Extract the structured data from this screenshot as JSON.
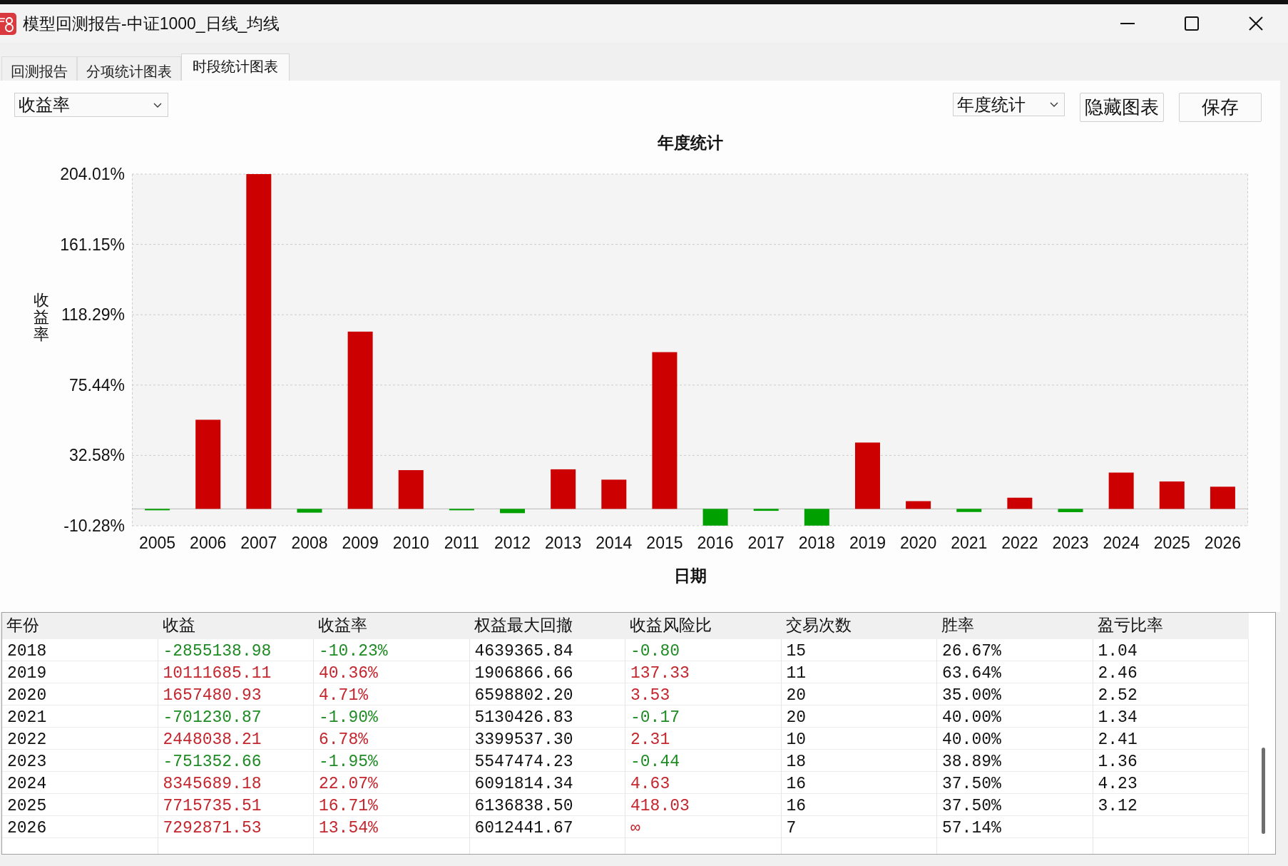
{
  "window": {
    "title": "模型回测报告-中证1000_日线_均线"
  },
  "tabs": [
    {
      "label": "回测报告",
      "selected": false
    },
    {
      "label": "分项统计图表",
      "selected": false
    },
    {
      "label": "时段统计图表",
      "selected": true
    }
  ],
  "toolbar": {
    "metric_select": {
      "value": "收益率"
    },
    "period_select": {
      "value": "年度统计"
    },
    "buttons": [
      "隐藏图表",
      "保存"
    ]
  },
  "chart": {
    "chart_data": [
      {
        "type": "bar",
        "title": "年度统计",
        "xlabel": "日期",
        "ylabel": "收益率",
        "categories": [
          "2005",
          "2006",
          "2007",
          "2008",
          "2009",
          "2010",
          "2011",
          "2012",
          "2013",
          "2014",
          "2015",
          "2016",
          "2017",
          "2018",
          "2019",
          "2020",
          "2021",
          "2022",
          "2023",
          "2024",
          "2025",
          "2026"
        ],
        "values": [
          -0.4,
          54.3,
          204.0,
          -2.3,
          108.0,
          23.6,
          -0.7,
          -2.6,
          24.1,
          17.8,
          95.5,
          -10.2,
          -1.2,
          -10.2,
          40.4,
          4.7,
          -1.9,
          6.8,
          -2.0,
          22.1,
          16.7,
          13.5
        ],
        "colors": [
          "#00a000",
          "#cc0000",
          "#cc0000",
          "#00a000",
          "#cc0000",
          "#cc0000",
          "#00a000",
          "#00a000",
          "#cc0000",
          "#cc0000",
          "#cc0000",
          "#00a000",
          "#00a000",
          "#00a000",
          "#cc0000",
          "#cc0000",
          "#00a000",
          "#cc0000",
          "#00a000",
          "#cc0000",
          "#cc0000",
          "#cc0000"
        ],
        "ylim": [
          -10.28,
          204.01
        ],
        "yticks": [
          {
            "value": -10.28,
            "label": "-10.28%"
          },
          {
            "value": 32.58,
            "label": "32.58%"
          },
          {
            "value": 75.44,
            "label": "75.44%"
          },
          {
            "value": 118.29,
            "label": "118.29%"
          },
          {
            "value": 161.15,
            "label": "161.15%"
          },
          {
            "value": 204.01,
            "label": "204.01%"
          }
        ],
        "grid": true
      }
    ]
  },
  "table": {
    "columns": [
      "年份",
      "收益",
      "收益率",
      "权益最大回撤",
      "收益风险比",
      "交易次数",
      "胜率",
      "盈亏比率"
    ],
    "rows": [
      {
        "cells": [
          {
            "text": "2018"
          },
          {
            "text": "-2855138.98",
            "color": "#1f8b24"
          },
          {
            "text": "-10.23%",
            "color": "#1f8b24"
          },
          {
            "text": "4639365.84"
          },
          {
            "text": "-0.80",
            "color": "#1f8b24"
          },
          {
            "text": "15"
          },
          {
            "text": "26.67%"
          },
          {
            "text": "1.04"
          }
        ]
      },
      {
        "cells": [
          {
            "text": "2019"
          },
          {
            "text": "10111685.11",
            "color": "#c4262e"
          },
          {
            "text": "40.36%",
            "color": "#c4262e"
          },
          {
            "text": "1906866.66"
          },
          {
            "text": "137.33",
            "color": "#c4262e"
          },
          {
            "text": "11"
          },
          {
            "text": "63.64%"
          },
          {
            "text": "2.46"
          }
        ]
      },
      {
        "cells": [
          {
            "text": "2020"
          },
          {
            "text": "1657480.93",
            "color": "#c4262e"
          },
          {
            "text": "4.71%",
            "color": "#c4262e"
          },
          {
            "text": "6598802.20"
          },
          {
            "text": "3.53",
            "color": "#c4262e"
          },
          {
            "text": "20"
          },
          {
            "text": "35.00%"
          },
          {
            "text": "2.52"
          }
        ]
      },
      {
        "cells": [
          {
            "text": "2021"
          },
          {
            "text": "-701230.87",
            "color": "#1f8b24"
          },
          {
            "text": "-1.90%",
            "color": "#1f8b24"
          },
          {
            "text": "5130426.83"
          },
          {
            "text": "-0.17",
            "color": "#1f8b24"
          },
          {
            "text": "20"
          },
          {
            "text": "40.00%"
          },
          {
            "text": "1.34"
          }
        ]
      },
      {
        "cells": [
          {
            "text": "2022"
          },
          {
            "text": "2448038.21",
            "color": "#c4262e"
          },
          {
            "text": "6.78%",
            "color": "#c4262e"
          },
          {
            "text": "3399537.30"
          },
          {
            "text": "2.31",
            "color": "#c4262e"
          },
          {
            "text": "10"
          },
          {
            "text": "40.00%"
          },
          {
            "text": "2.41"
          }
        ]
      },
      {
        "cells": [
          {
            "text": "2023"
          },
          {
            "text": "-751352.66",
            "color": "#1f8b24"
          },
          {
            "text": "-1.95%",
            "color": "#1f8b24"
          },
          {
            "text": "5547474.23"
          },
          {
            "text": "-0.44",
            "color": "#1f8b24"
          },
          {
            "text": "18"
          },
          {
            "text": "38.89%"
          },
          {
            "text": "1.36"
          }
        ]
      },
      {
        "cells": [
          {
            "text": "2024"
          },
          {
            "text": "8345689.18",
            "color": "#c4262e"
          },
          {
            "text": "22.07%",
            "color": "#c4262e"
          },
          {
            "text": "6091814.34"
          },
          {
            "text": "4.63",
            "color": "#c4262e"
          },
          {
            "text": "16"
          },
          {
            "text": "37.50%"
          },
          {
            "text": "4.23"
          }
        ]
      },
      {
        "cells": [
          {
            "text": "2025"
          },
          {
            "text": "7715735.51",
            "color": "#c4262e"
          },
          {
            "text": "16.71%",
            "color": "#c4262e"
          },
          {
            "text": "6136838.50"
          },
          {
            "text": "418.03",
            "color": "#c4262e"
          },
          {
            "text": "16"
          },
          {
            "text": "37.50%"
          },
          {
            "text": "3.12"
          }
        ]
      },
      {
        "cells": [
          {
            "text": "2026"
          },
          {
            "text": "7292871.53",
            "color": "#c4262e"
          },
          {
            "text": "13.54%",
            "color": "#c4262e"
          },
          {
            "text": "6012441.67"
          },
          {
            "text": "∞",
            "color": "#c4262e"
          },
          {
            "text": "7"
          },
          {
            "text": "57.14%"
          }
        ]
      }
    ]
  }
}
